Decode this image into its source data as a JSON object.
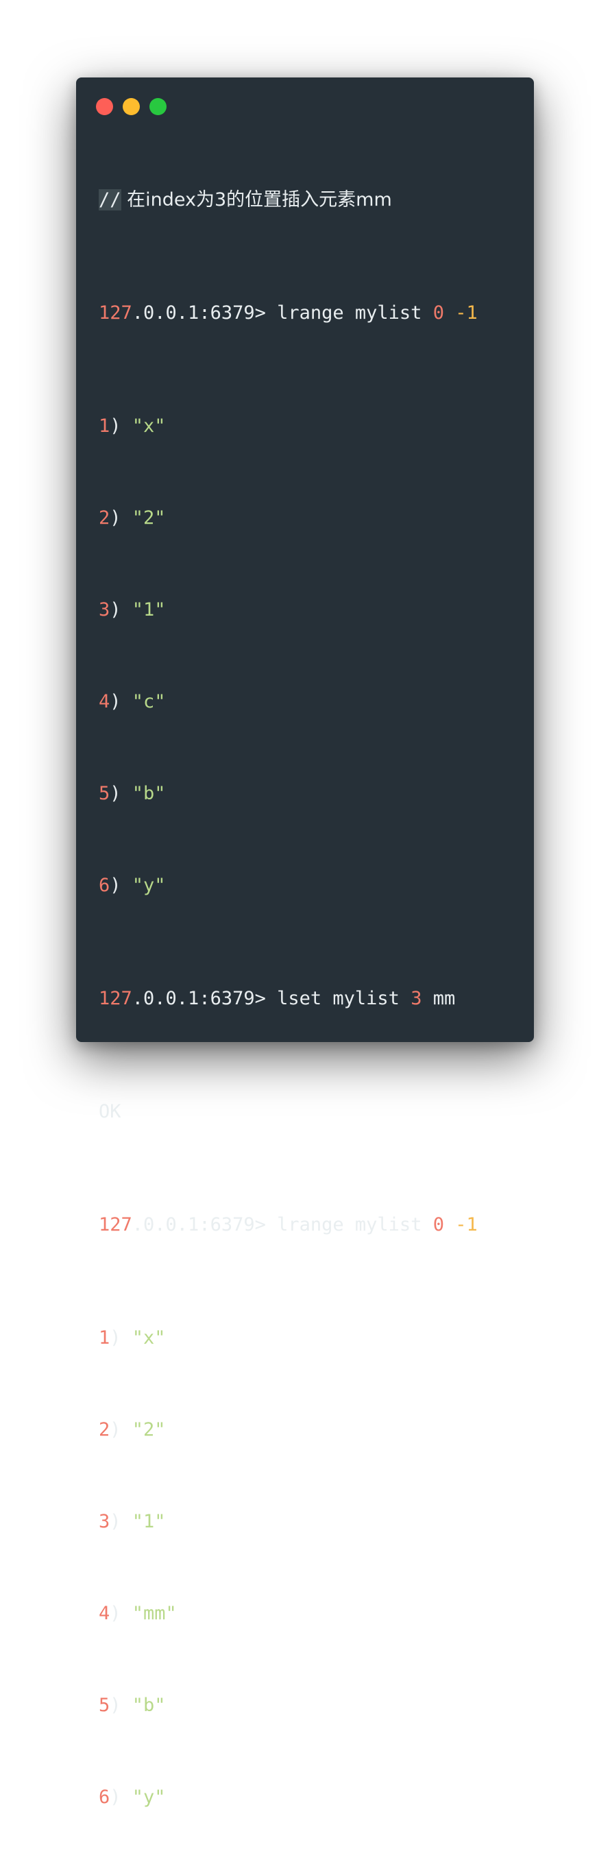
{
  "window": {
    "traffic_lights": [
      {
        "name": "close",
        "color": "#fe5f57"
      },
      {
        "name": "minimize",
        "color": "#febc2e"
      },
      {
        "name": "zoom",
        "color": "#28c840"
      }
    ]
  },
  "colors": {
    "background": "#263038",
    "text": "#e9eef0",
    "number": "#f07a6a",
    "negative_number": "#f5b84b",
    "string": "#b8d98a"
  },
  "terminal": {
    "comment": {
      "marker": "//",
      "text": " 在index为3的位置插入元素mm"
    },
    "prompt_host_num": "127",
    "prompt_host_rest": ".0.0.1:6379>",
    "cmd1": {
      "text": " lrange mylist ",
      "start": "0",
      "end": "-1"
    },
    "result1": [
      {
        "index": "1",
        "sep": ") ",
        "value": "\"x\""
      },
      {
        "index": "2",
        "sep": ") ",
        "value": "\"2\""
      },
      {
        "index": "3",
        "sep": ") ",
        "value": "\"1\""
      },
      {
        "index": "4",
        "sep": ") ",
        "value": "\"c\""
      },
      {
        "index": "5",
        "sep": ") ",
        "value": "\"b\""
      },
      {
        "index": "6",
        "sep": ") ",
        "value": "\"y\""
      }
    ],
    "cmd2": {
      "text": " lset mylist ",
      "index": "3",
      "value": " mm"
    },
    "ok": "OK",
    "cmd3": {
      "text": " lrange mylist ",
      "start": "0",
      "end": "-1"
    },
    "result2": [
      {
        "index": "1",
        "sep": ") ",
        "value": "\"x\""
      },
      {
        "index": "2",
        "sep": ") ",
        "value": "\"2\""
      },
      {
        "index": "3",
        "sep": ") ",
        "value": "\"1\""
      },
      {
        "index": "4",
        "sep": ") ",
        "value": "\"mm\""
      },
      {
        "index": "5",
        "sep": ") ",
        "value": "\"b\""
      },
      {
        "index": "6",
        "sep": ") ",
        "value": "\"y\""
      }
    ]
  }
}
